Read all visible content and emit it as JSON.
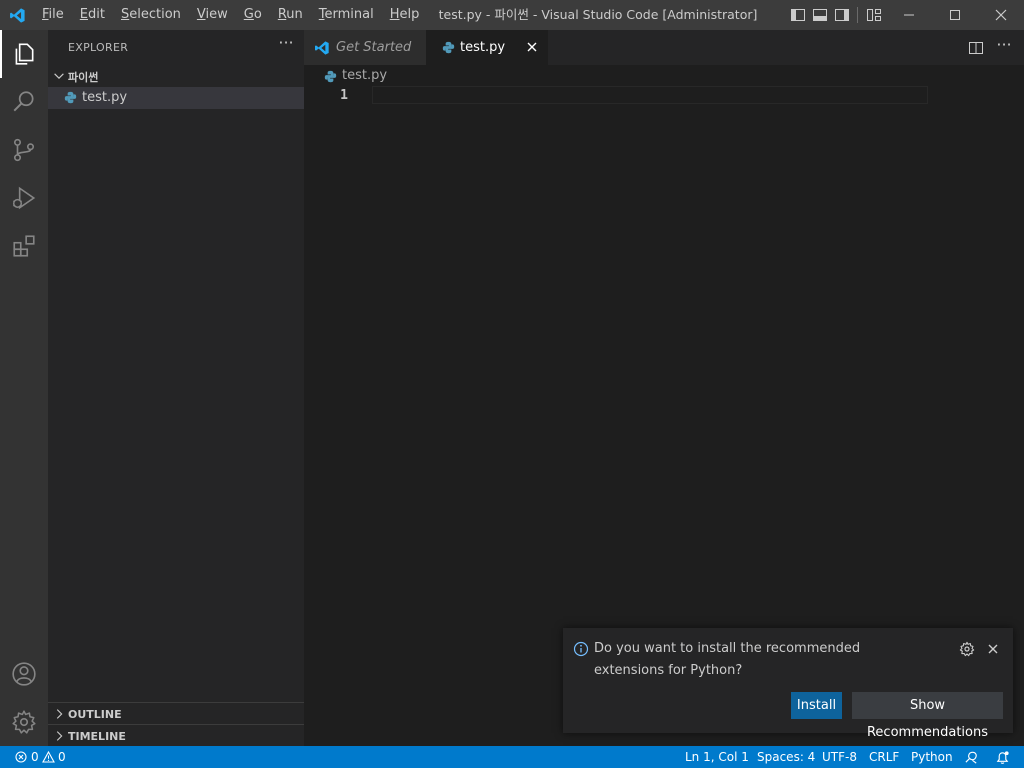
{
  "titlebar": {
    "menu": [
      "File",
      "Edit",
      "Selection",
      "View",
      "Go",
      "Run",
      "Terminal",
      "Help"
    ],
    "window_title": "test.py - 파이썬 - Visual Studio Code [Administrator]"
  },
  "sidebar": {
    "title": "EXPLORER",
    "more": "···",
    "folder": "파이썬",
    "files": [
      "test.py"
    ],
    "panels": [
      "OUTLINE",
      "TIMELINE"
    ]
  },
  "editor": {
    "tabs": [
      {
        "label": "Get Started",
        "active": false
      },
      {
        "label": "test.py",
        "active": true
      }
    ],
    "breadcrumb": "test.py",
    "line_numbers": [
      "1"
    ]
  },
  "notification": {
    "message": "Do you want to install the recommended extensions for Python?",
    "install_label": "Install",
    "show_recommendations_label": "Show Recommendations"
  },
  "statusbar": {
    "errors": "0",
    "warnings": "0",
    "position": "Ln 1, Col 1",
    "spaces": "Spaces: 4",
    "encoding": "UTF-8",
    "eol": "CRLF",
    "language": "Python"
  },
  "colors": {
    "accent": "#007acc",
    "python_icon": "#519aba",
    "vscode_logo": "#23a9f2"
  },
  "icons": [
    "vscode-logo-icon",
    "explorer-icon",
    "search-icon",
    "source-control-icon",
    "run-debug-icon",
    "extensions-icon",
    "account-icon",
    "manage-gear-icon",
    "python-file-icon",
    "info-icon",
    "close-icon",
    "split-editor-icon",
    "bell-icon",
    "feedback-icon"
  ]
}
